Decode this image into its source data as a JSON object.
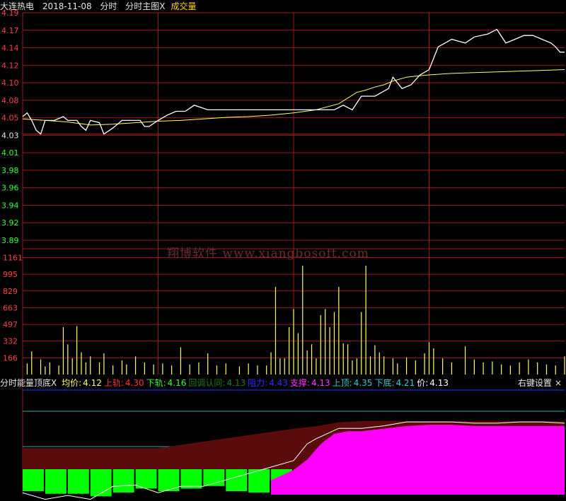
{
  "header": {
    "stock_name": "大连热电",
    "date": "2018-11-08",
    "mode": "分时",
    "main_chart": "分时主图",
    "close_mark": "X",
    "volume_label": "成交量"
  },
  "watermark": "翔博软件 www.xiangbosoft.com",
  "indicator_bar": {
    "name": "分时能量顶底",
    "close_mark": "X",
    "items": [
      {
        "label": "均价:",
        "value": "4.12",
        "color": "#ffff66"
      },
      {
        "label": "上轨:",
        "value": "4.30",
        "color": "#ff3030"
      },
      {
        "label": "下轨:",
        "value": "4.16",
        "color": "#33ff33"
      },
      {
        "label": "回调认同:",
        "value": "4.13",
        "color": "#1f7a1f"
      },
      {
        "label": "阻力:",
        "value": "4.43",
        "color": "#3030ff"
      },
      {
        "label": "支撑:",
        "value": "4.13",
        "color": "#ff33ff"
      },
      {
        "label": "上顶:",
        "value": "4.35",
        "color": "#33cccc"
      },
      {
        "label": "下底:",
        "value": "4.21",
        "color": "#33cccc"
      },
      {
        "label": "价:",
        "value": "4.13",
        "color": "#ffffff"
      }
    ],
    "right_settings": "右键设置",
    "right_close": "×"
  },
  "colors": {
    "grid": "#a01818",
    "price_line": "#ffffff",
    "avg_line": "#ffff66",
    "volume": "#ffff66",
    "up_label": "#ff4040",
    "down_label": "#33ff33",
    "energy_red": "#5a0c0c",
    "energy_green": "#00ff00",
    "energy_magenta": "#ff00ff",
    "rail_cyan": "#33aaaa",
    "rail_blue": "#2233ff"
  },
  "chart_data": [
    {
      "type": "line",
      "name": "price",
      "y_ticks": [
        "4.19",
        "4.17",
        "4.14",
        "4.12",
        "4.10",
        "4.08",
        "4.05",
        "4.03",
        "4.01",
        "3.98",
        "3.96",
        "3.94",
        "3.92",
        "3.89"
      ],
      "pre_close": 4.03,
      "ylim": [
        3.89,
        4.19
      ],
      "x_range": [
        0,
        240
      ],
      "series": [
        {
          "values": [
            [
              0,
              4.053
            ],
            [
              2,
              4.058
            ],
            [
              4,
              4.048
            ],
            [
              6,
              4.035
            ],
            [
              8,
              4.03
            ],
            [
              10,
              4.048
            ],
            [
              14,
              4.048
            ],
            [
              18,
              4.053
            ],
            [
              20,
              4.048
            ],
            [
              24,
              4.048
            ],
            [
              26,
              4.04
            ],
            [
              28,
              4.035
            ],
            [
              30,
              4.048
            ],
            [
              34,
              4.045
            ],
            [
              36,
              4.03
            ],
            [
              40,
              4.038
            ],
            [
              44,
              4.048
            ],
            [
              48,
              4.048
            ],
            [
              52,
              4.048
            ],
            [
              54,
              4.04
            ],
            [
              56,
              4.04
            ],
            [
              60,
              4.048
            ],
            [
              64,
              4.055
            ],
            [
              68,
              4.06
            ],
            [
              72,
              4.06
            ],
            [
              76,
              4.068
            ],
            [
              82,
              4.062
            ],
            [
              86,
              4.062
            ],
            [
              92,
              4.062
            ],
            [
              96,
              4.062
            ],
            [
              100,
              4.062
            ],
            [
              104,
              4.062
            ],
            [
              108,
              4.062
            ],
            [
              112,
              4.062
            ],
            [
              118,
              4.062
            ],
            [
              124,
              4.062
            ],
            [
              130,
              4.062
            ],
            [
              134,
              4.062
            ],
            [
              138,
              4.062
            ],
            [
              142,
              4.068
            ],
            [
              146,
              4.062
            ],
            [
              150,
              4.08
            ],
            [
              156,
              4.08
            ],
            [
              162,
              4.09
            ],
            [
              164,
              4.105
            ],
            [
              168,
              4.09
            ],
            [
              172,
              4.095
            ],
            [
              176,
              4.108
            ],
            [
              180,
              4.115
            ],
            [
              184,
              4.145
            ],
            [
              190,
              4.155
            ],
            [
              196,
              4.15
            ],
            [
              200,
              4.158
            ],
            [
              206,
              4.162
            ],
            [
              210,
              4.168
            ],
            [
              214,
              4.15
            ],
            [
              218,
              4.155
            ],
            [
              222,
              4.16
            ],
            [
              226,
              4.16
            ],
            [
              230,
              4.155
            ],
            [
              234,
              4.15
            ],
            [
              236,
              4.145
            ],
            [
              238,
              4.138
            ],
            [
              240,
              4.138
            ]
          ]
        },
        {
          "values": [
            [
              0,
              4.05
            ],
            [
              10,
              4.048
            ],
            [
              20,
              4.046
            ],
            [
              30,
              4.042
            ],
            [
              40,
              4.043
            ],
            [
              50,
              4.045
            ],
            [
              60,
              4.047
            ],
            [
              70,
              4.048
            ],
            [
              80,
              4.05
            ],
            [
              90,
              4.052
            ],
            [
              100,
              4.053
            ],
            [
              110,
              4.055
            ],
            [
              120,
              4.058
            ],
            [
              130,
              4.062
            ],
            [
              140,
              4.07
            ],
            [
              148,
              4.085
            ],
            [
              152,
              4.088
            ],
            [
              156,
              4.092
            ],
            [
              160,
              4.095
            ],
            [
              164,
              4.1
            ],
            [
              170,
              4.105
            ],
            [
              176,
              4.107
            ],
            [
              180,
              4.108
            ],
            [
              190,
              4.11
            ],
            [
              200,
              4.111
            ],
            [
              210,
              4.112
            ],
            [
              220,
              4.113
            ],
            [
              230,
              4.114
            ],
            [
              240,
              4.115
            ]
          ]
        }
      ]
    },
    {
      "type": "bar",
      "name": "volume",
      "y_ticks": [
        "1161",
        "995",
        "829",
        "663",
        "497",
        "332",
        "166"
      ],
      "ylim": [
        0,
        1161
      ],
      "values": [
        [
          2,
          110
        ],
        [
          4,
          230
        ],
        [
          8,
          150
        ],
        [
          10,
          80
        ],
        [
          12,
          120
        ],
        [
          16,
          90
        ],
        [
          18,
          470
        ],
        [
          20,
          300
        ],
        [
          22,
          160
        ],
        [
          24,
          480
        ],
        [
          26,
          220
        ],
        [
          28,
          120
        ],
        [
          30,
          180
        ],
        [
          34,
          120
        ],
        [
          36,
          210
        ],
        [
          40,
          90
        ],
        [
          44,
          140
        ],
        [
          46,
          100
        ],
        [
          50,
          180
        ],
        [
          54,
          120
        ],
        [
          58,
          100
        ],
        [
          62,
          110
        ],
        [
          66,
          90
        ],
        [
          70,
          270
        ],
        [
          74,
          100
        ],
        [
          78,
          120
        ],
        [
          82,
          210
        ],
        [
          86,
          90
        ],
        [
          90,
          110
        ],
        [
          96,
          80
        ],
        [
          100,
          110
        ],
        [
          104,
          90
        ],
        [
          108,
          90
        ],
        [
          110,
          220
        ],
        [
          112,
          870
        ],
        [
          114,
          160
        ],
        [
          116,
          160
        ],
        [
          118,
          470
        ],
        [
          120,
          650
        ],
        [
          122,
          410
        ],
        [
          124,
          1080
        ],
        [
          126,
          240
        ],
        [
          128,
          300
        ],
        [
          130,
          160
        ],
        [
          132,
          590
        ],
        [
          134,
          650
        ],
        [
          136,
          470
        ],
        [
          138,
          620
        ],
        [
          140,
          870
        ],
        [
          142,
          310
        ],
        [
          144,
          300
        ],
        [
          146,
          140
        ],
        [
          148,
          160
        ],
        [
          150,
          620
        ],
        [
          152,
          1080
        ],
        [
          154,
          180
        ],
        [
          156,
          290
        ],
        [
          158,
          220
        ],
        [
          160,
          180
        ],
        [
          164,
          160
        ],
        [
          166,
          110
        ],
        [
          170,
          170
        ],
        [
          174,
          140
        ],
        [
          178,
          210
        ],
        [
          180,
          320
        ],
        [
          182,
          260
        ],
        [
          186,
          160
        ],
        [
          190,
          120
        ],
        [
          196,
          280
        ],
        [
          200,
          150
        ],
        [
          204,
          120
        ],
        [
          208,
          130
        ],
        [
          212,
          100
        ],
        [
          216,
          90
        ],
        [
          220,
          120
        ],
        [
          224,
          150
        ],
        [
          228,
          120
        ],
        [
          232,
          100
        ],
        [
          236,
          90
        ],
        [
          240,
          180
        ]
      ]
    },
    {
      "type": "area",
      "name": "energy",
      "series": [
        {
          "name": "red_area",
          "values": [
            [
              0,
              0.45
            ],
            [
              60,
              0.45
            ],
            [
              120,
              0.3
            ],
            [
              130,
              0.28
            ],
            [
              140,
              0.25
            ],
            [
              150,
              0.24
            ],
            [
              180,
              0.24
            ],
            [
              240,
              0.24
            ]
          ]
        },
        {
          "name": "green_bars",
          "values": [
            [
              0,
              0.62
            ],
            [
              10,
              0.64
            ],
            [
              20,
              0.64
            ],
            [
              30,
              0.66
            ],
            [
              40,
              0.63
            ],
            [
              50,
              0.6
            ],
            [
              60,
              0.62
            ],
            [
              70,
              0.6
            ],
            [
              80,
              0.58
            ],
            [
              90,
              0.62
            ],
            [
              100,
              0.63
            ],
            [
              110,
              0.6
            ],
            [
              120,
              0.55
            ],
            [
              126,
              0.48
            ],
            [
              130,
              0.35
            ]
          ]
        },
        {
          "name": "magenta_area",
          "values": [
            [
              110,
              0.48
            ],
            [
              120,
              0.4
            ],
            [
              126,
              0.32
            ],
            [
              132,
              0.2
            ],
            [
              138,
              0.12
            ],
            [
              144,
              0.1
            ],
            [
              150,
              0.1
            ],
            [
              160,
              0.08
            ],
            [
              170,
              0.06
            ],
            [
              180,
              0.05
            ],
            [
              190,
              0.05
            ],
            [
              200,
              0.06
            ],
            [
              210,
              0.06
            ],
            [
              220,
              0.06
            ],
            [
              230,
              0.06
            ],
            [
              240,
              0.06
            ]
          ]
        },
        {
          "name": "white_line",
          "values": [
            [
              0,
              0.6
            ],
            [
              10,
              0.65
            ],
            [
              20,
              0.62
            ],
            [
              30,
              0.65
            ],
            [
              40,
              0.55
            ],
            [
              50,
              0.54
            ],
            [
              60,
              0.6
            ],
            [
              70,
              0.55
            ],
            [
              80,
              0.55
            ],
            [
              90,
              0.5
            ],
            [
              100,
              0.45
            ],
            [
              110,
              0.4
            ],
            [
              120,
              0.35
            ],
            [
              126,
              0.22
            ],
            [
              130,
              0.18
            ],
            [
              140,
              0.1
            ],
            [
              150,
              0.1
            ],
            [
              160,
              0.08
            ],
            [
              170,
              0.05
            ],
            [
              180,
              0.05
            ],
            [
              190,
              0.05
            ],
            [
              200,
              0.06
            ],
            [
              210,
              0.06
            ],
            [
              220,
              0.05
            ],
            [
              230,
              0.05
            ],
            [
              240,
              0.06
            ]
          ]
        }
      ]
    }
  ]
}
